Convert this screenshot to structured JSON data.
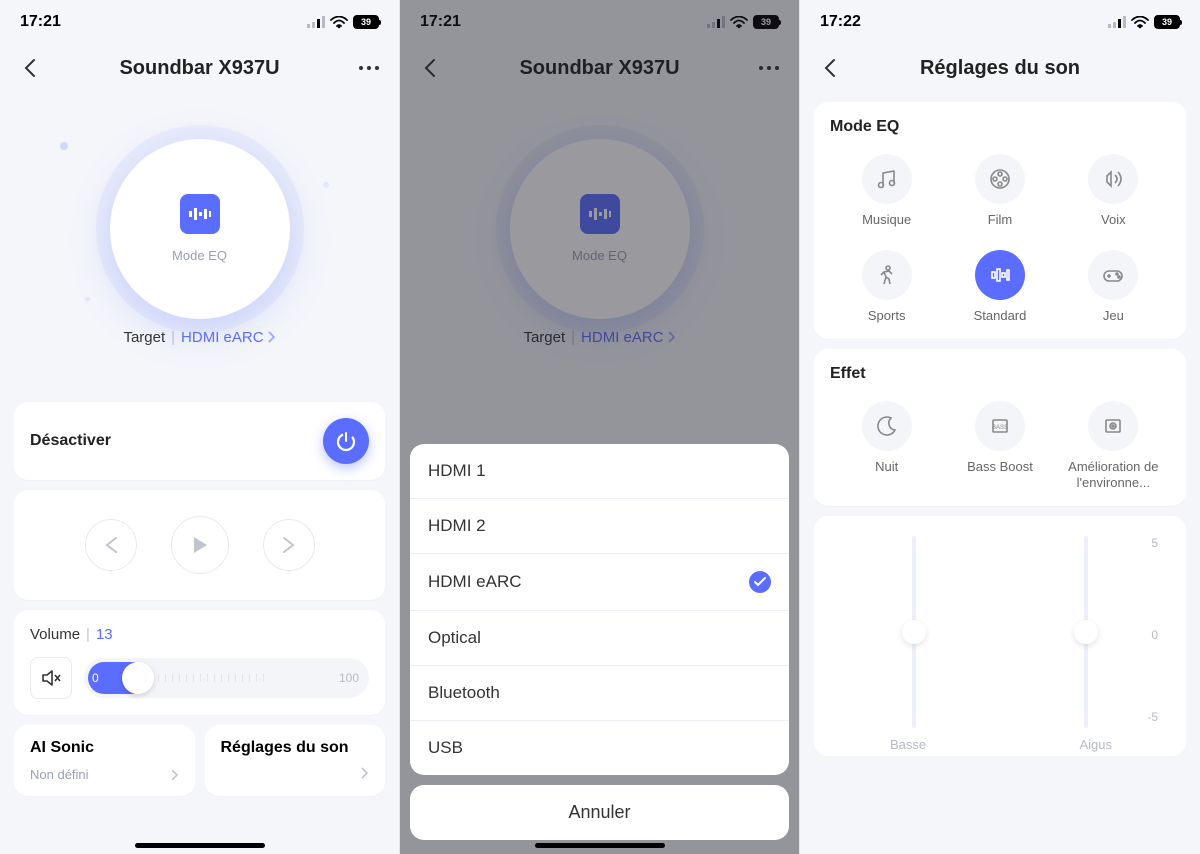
{
  "screen1": {
    "statusbar": {
      "time": "17:21",
      "battery": "39"
    },
    "header": {
      "title": "Soundbar X937U"
    },
    "hero": {
      "mode_label": "Mode EQ",
      "target_label": "Target",
      "target_selected": "HDMI eARC"
    },
    "power": {
      "label": "Désactiver"
    },
    "volume": {
      "label": "Volume",
      "value": "13",
      "min": "0",
      "max": "100"
    },
    "ai_sonic": {
      "title": "AI Sonic",
      "value": "Non défini"
    },
    "sound_settings": {
      "title": "Réglages du son"
    }
  },
  "screen2": {
    "statusbar": {
      "time": "17:21",
      "battery": "39"
    },
    "header": {
      "title": "Soundbar X937U"
    },
    "hero": {
      "mode_label": "Mode EQ",
      "target_label": "Target",
      "target_selected": "HDMI eARC"
    },
    "options": [
      {
        "label": "HDMI 1",
        "selected": false
      },
      {
        "label": "HDMI 2",
        "selected": false
      },
      {
        "label": "HDMI eARC",
        "selected": true
      },
      {
        "label": "Optical",
        "selected": false
      },
      {
        "label": "Bluetooth",
        "selected": false
      },
      {
        "label": "USB",
        "selected": false
      }
    ],
    "cancel": "Annuler"
  },
  "screen3": {
    "statusbar": {
      "time": "17:22",
      "battery": "39"
    },
    "header": {
      "title": "Réglages du son"
    },
    "eq": {
      "title": "Mode EQ",
      "modes": [
        {
          "label": "Musique",
          "icon": "music"
        },
        {
          "label": "Film",
          "icon": "film"
        },
        {
          "label": "Voix",
          "icon": "voice"
        },
        {
          "label": "Sports",
          "icon": "sports"
        },
        {
          "label": "Standard",
          "icon": "eq",
          "active": true
        },
        {
          "label": "Jeu",
          "icon": "game"
        }
      ]
    },
    "effect": {
      "title": "Effet",
      "items": [
        {
          "label": "Nuit",
          "icon": "moon"
        },
        {
          "label": "Bass Boost",
          "icon": "bass"
        },
        {
          "label": "Amélioration de l'environne...",
          "icon": "surround"
        }
      ]
    },
    "sliders": {
      "bass_label": "Basse",
      "treble_label": "Aigus",
      "scale_top": "5",
      "scale_mid": "0",
      "scale_bot": "-5"
    }
  }
}
